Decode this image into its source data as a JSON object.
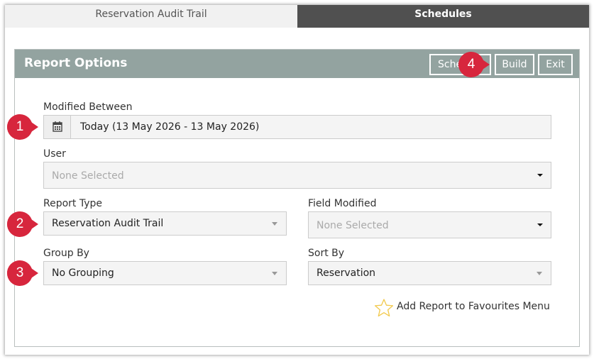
{
  "tabs": {
    "reservation_audit_trail": "Reservation Audit Trail",
    "schedules": "Schedules"
  },
  "panel": {
    "title": "Report Options",
    "buttons": {
      "schedule": "Schedule",
      "build": "Build",
      "exit": "Exit"
    }
  },
  "form": {
    "modified_between": {
      "label": "Modified Between",
      "value": "Today (13 May 2026 - 13 May 2026)",
      "icon": "calendar-icon"
    },
    "user": {
      "label": "User",
      "placeholder": "None Selected"
    },
    "report_type": {
      "label": "Report Type",
      "value": "Reservation Audit Trail"
    },
    "field_modified": {
      "label": "Field Modified",
      "placeholder": "None Selected"
    },
    "group_by": {
      "label": "Group By",
      "value": "No Grouping"
    },
    "sort_by": {
      "label": "Sort By",
      "value": "Reservation"
    }
  },
  "favourites": {
    "label": "Add Report to Favourites Menu",
    "icon": "star-outline-icon",
    "color": "#f2c94c"
  },
  "markers": [
    "1",
    "2",
    "3",
    "4"
  ],
  "colors": {
    "header": "#93a3a0",
    "active_tab": "#505050",
    "marker": "#d7263d"
  }
}
